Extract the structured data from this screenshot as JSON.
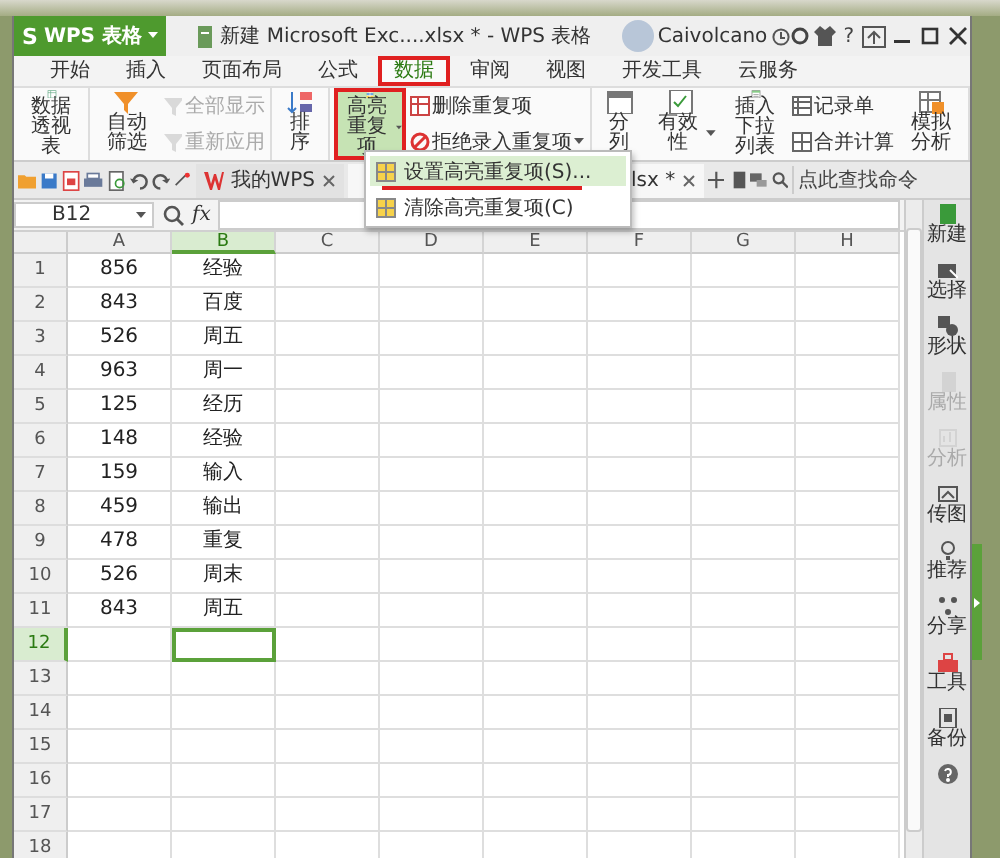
{
  "window": {
    "app_logo": "S",
    "app_name": "WPS 表格",
    "title": "新建 Microsoft Exc....xlsx * - WPS 表格",
    "user": "Caivolcano",
    "help": "?"
  },
  "ribbon_tabs": [
    {
      "label": "开始",
      "selected": false,
      "marked": false
    },
    {
      "label": "插入",
      "selected": false,
      "marked": false
    },
    {
      "label": "页面布局",
      "selected": false,
      "marked": false
    },
    {
      "label": "公式",
      "selected": false,
      "marked": false
    },
    {
      "label": "数据",
      "selected": true,
      "marked": true
    },
    {
      "label": "审阅",
      "selected": false,
      "marked": false
    },
    {
      "label": "视图",
      "selected": false,
      "marked": false
    },
    {
      "label": "开发工具",
      "selected": false,
      "marked": false
    },
    {
      "label": "云服务",
      "selected": false,
      "marked": false
    }
  ],
  "ribbon_groups": [
    [
      {
        "kind": "large",
        "label": "数据透视表",
        "disabled": false,
        "dropdown": false
      }
    ],
    [
      {
        "kind": "large",
        "label": "自动筛选",
        "disabled": false,
        "dropdown": false
      },
      {
        "kind": "small",
        "label": "全部显示",
        "disabled": true,
        "dropdown": false
      },
      {
        "kind": "small",
        "label": "重新应用",
        "disabled": true,
        "dropdown": false
      }
    ],
    [
      {
        "kind": "large",
        "label": "排序",
        "disabled": false,
        "dropdown": false
      }
    ],
    [
      {
        "kind": "large",
        "label": "高亮重复项",
        "disabled": false,
        "dropdown": true,
        "pressed": true,
        "marked": true
      },
      {
        "kind": "small",
        "label": "删除重复项",
        "disabled": false,
        "dropdown": false
      },
      {
        "kind": "small",
        "label": "拒绝录入重复项",
        "disabled": false,
        "dropdown": true
      }
    ],
    [
      {
        "kind": "large",
        "label": "分列",
        "disabled": false,
        "dropdown": false
      },
      {
        "kind": "large",
        "label": "有效性",
        "disabled": false,
        "dropdown": true
      },
      {
        "kind": "large",
        "label": "插入下拉列表",
        "disabled": false,
        "dropdown": false
      },
      {
        "kind": "small",
        "label": "记录单",
        "disabled": false,
        "dropdown": false
      },
      {
        "kind": "small",
        "label": "合并计算",
        "disabled": false,
        "dropdown": false
      },
      {
        "kind": "large",
        "label": "模拟分析",
        "disabled": false,
        "dropdown": false
      }
    ]
  ],
  "doc_tabs": [
    {
      "label": "我的WPS",
      "selected": false
    },
    {
      "label": "lsx *",
      "selected": true
    }
  ],
  "search": {
    "placeholder": "点此查找命令"
  },
  "dropdown_menu": [
    {
      "label": "设置高亮重复项(S)...",
      "selected": true,
      "marked": true
    },
    {
      "label": "清除高亮重复项(C)",
      "selected": false,
      "marked": false
    }
  ],
  "formula_bar": {
    "cell": "B12",
    "fx": "fx"
  },
  "sheet": {
    "columns": [
      {
        "label": "A",
        "selected": false
      },
      {
        "label": "B",
        "selected": true
      },
      {
        "label": "C",
        "selected": false
      },
      {
        "label": "D",
        "selected": false
      },
      {
        "label": "E",
        "selected": false
      },
      {
        "label": "F",
        "selected": false
      },
      {
        "label": "G",
        "selected": false
      },
      {
        "label": "H",
        "selected": false
      }
    ],
    "rows": [
      {
        "number": "1",
        "selected": false,
        "cells": [
          {
            "text": "856",
            "selected": false
          },
          {
            "text": "经验",
            "selected": false
          }
        ]
      },
      {
        "number": "2",
        "selected": false,
        "cells": [
          {
            "text": "843",
            "selected": false
          },
          {
            "text": "百度",
            "selected": false
          }
        ]
      },
      {
        "number": "3",
        "selected": false,
        "cells": [
          {
            "text": "526",
            "selected": false
          },
          {
            "text": "周五",
            "selected": false
          }
        ]
      },
      {
        "number": "4",
        "selected": false,
        "cells": [
          {
            "text": "963",
            "selected": false
          },
          {
            "text": "周一",
            "selected": false
          }
        ]
      },
      {
        "number": "5",
        "selected": false,
        "cells": [
          {
            "text": "125",
            "selected": false
          },
          {
            "text": "经历",
            "selected": false
          }
        ]
      },
      {
        "number": "6",
        "selected": false,
        "cells": [
          {
            "text": "148",
            "selected": false
          },
          {
            "text": "经验",
            "selected": false
          }
        ]
      },
      {
        "number": "7",
        "selected": false,
        "cells": [
          {
            "text": "159",
            "selected": false
          },
          {
            "text": "输入",
            "selected": false
          }
        ]
      },
      {
        "number": "8",
        "selected": false,
        "cells": [
          {
            "text": "459",
            "selected": false
          },
          {
            "text": "输出",
            "selected": false
          }
        ]
      },
      {
        "number": "9",
        "selected": false,
        "cells": [
          {
            "text": "478",
            "selected": false
          },
          {
            "text": "重复",
            "selected": false
          }
        ]
      },
      {
        "number": "10",
        "selected": false,
        "cells": [
          {
            "text": "526",
            "selected": false
          },
          {
            "text": "周末",
            "selected": false
          }
        ]
      },
      {
        "number": "11",
        "selected": false,
        "cells": [
          {
            "text": "843",
            "selected": false
          },
          {
            "text": "周五",
            "selected": false
          }
        ]
      },
      {
        "number": "12",
        "selected": true,
        "cells": [
          {
            "selected": false
          },
          {
            "selected": true
          }
        ]
      },
      {
        "number": "13",
        "selected": false
      },
      {
        "number": "14",
        "selected": false
      },
      {
        "number": "15",
        "selected": false
      },
      {
        "number": "16",
        "selected": false
      },
      {
        "number": "17",
        "selected": false
      },
      {
        "number": "18",
        "selected": false
      }
    ]
  },
  "task_pane": [
    {
      "label": "新建",
      "disabled": false
    },
    {
      "label": "选择",
      "disabled": false
    },
    {
      "label": "形状",
      "disabled": false
    },
    {
      "label": "属性",
      "disabled": true
    },
    {
      "label": "分析",
      "disabled": true
    },
    {
      "label": "传图",
      "disabled": false
    },
    {
      "label": "推荐",
      "disabled": false
    },
    {
      "label": "分享",
      "disabled": false
    },
    {
      "label": "工具",
      "disabled": false
    },
    {
      "label": "备份",
      "disabled": false
    },
    {
      "disabled": false
    }
  ]
}
